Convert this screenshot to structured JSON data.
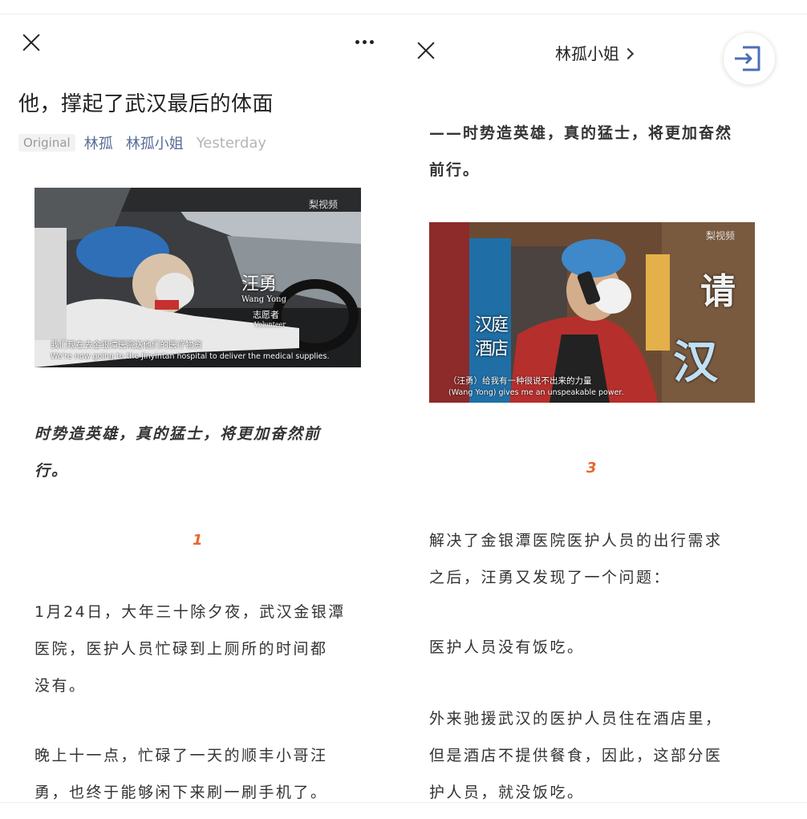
{
  "left": {
    "title": "他，撑起了武汉最后的体面",
    "meta": {
      "original": "Original",
      "author": "林孤",
      "account": "林孤小姐",
      "time": "Yesterday"
    },
    "video": {
      "name_cn": "汪勇",
      "name_en": "Wang Yong",
      "role_cn": "志愿者",
      "role_en": "Volunteer",
      "brand": "梨视频",
      "sub_cn": "我们现在去金银潭医院送他们的医疗物资",
      "sub_en": "We're now going to the Jinyintan hospital to deliver the medical supplies."
    },
    "quote": [
      "时势造英雄，真的猛士，将更加奋然前",
      "行。"
    ],
    "section": "1",
    "para1": [
      "1月24日，大年三十除夕夜，武汉金银潭",
      "医院，医护人员忙碌到上厕所的时间都",
      "没有。"
    ],
    "para2": [
      "晚上十一点，忙碌了一天的顺丰小哥汪",
      "勇，也终于能够闲下来刷一刷手机了。"
    ]
  },
  "right": {
    "account": "林孤小姐",
    "quote": [
      "——时势造英雄，真的猛士，将更加奋然",
      "前行。"
    ],
    "video": {
      "brand": "梨视频",
      "sign_hotel_1": "汉",
      "sign_hotel_2": "庭",
      "sign_hotel_3": "酒",
      "sign_hotel_4": "店",
      "sign_big_1": "请",
      "sign_big_2": "汉",
      "sub_cn": "（汪勇）给我有一种很说不出来的力量",
      "sub_en": "(Wang Yong) gives me an unspeakable power."
    },
    "section": "3",
    "para1": [
      "解决了金银潭医院医护人员的出行需求",
      "之后，汪勇又发现了一个问题："
    ],
    "para2": [
      "医护人员没有饭吃。"
    ],
    "para3": [
      "外来驰援武汉的医护人员住在酒店里，",
      "但是酒店不提供餐食，因此，这部分医",
      "护人员，就没饭吃。"
    ]
  },
  "colors": {
    "link": "#576b95",
    "accent": "#e9662c",
    "text": "#333333"
  }
}
